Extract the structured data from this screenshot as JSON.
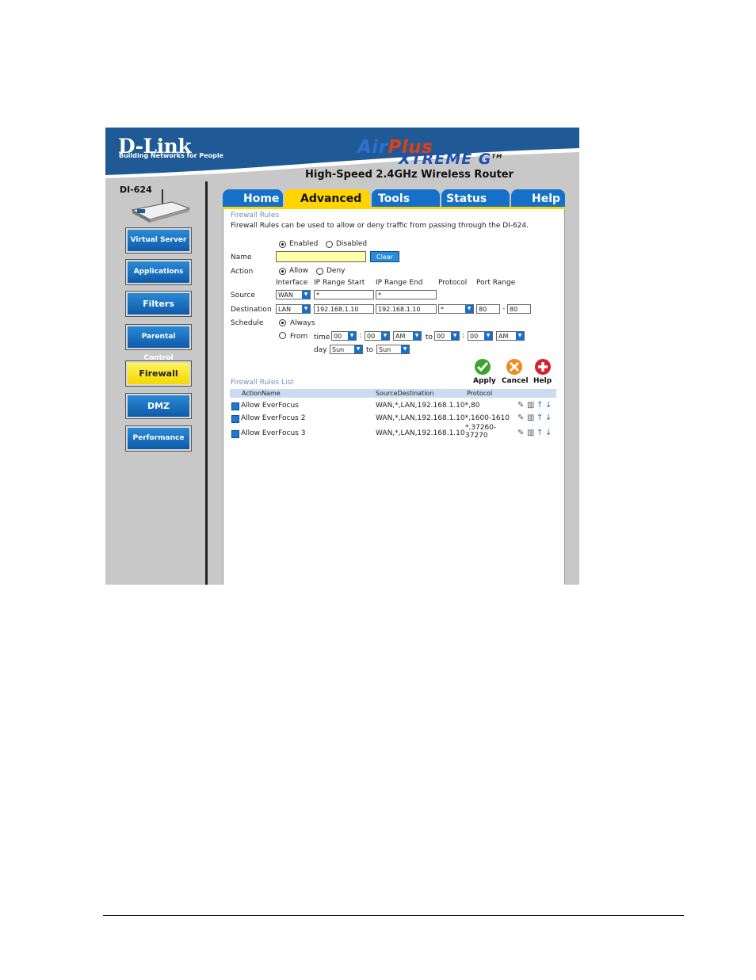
{
  "header": {
    "brand": "D-Link",
    "tagline": "Building Networks for People",
    "product_air": "Air",
    "product_plus": "Plus",
    "product_xtreme": "XTREME G",
    "trademark": "TM",
    "subtitle": "High-Speed 2.4GHz Wireless Router"
  },
  "sidebar": {
    "model": "DI-624",
    "items": [
      {
        "label": "Virtual Server"
      },
      {
        "label": "Applications"
      },
      {
        "label": "Filters"
      },
      {
        "label": "Parental Control"
      },
      {
        "label": "Firewall"
      },
      {
        "label": "DMZ"
      },
      {
        "label": "Performance"
      }
    ]
  },
  "tabs": [
    {
      "label": "Home"
    },
    {
      "label": "Advanced"
    },
    {
      "label": "Tools"
    },
    {
      "label": "Status"
    },
    {
      "label": "Help"
    }
  ],
  "form": {
    "heading": "Firewall Rules",
    "description": "Firewall Rules can be used to allow or deny traffic from passing through the DI-624.",
    "enabled_label": "Enabled",
    "disabled_label": "Disabled",
    "name_label": "Name",
    "name_value": "",
    "clear_label": "Clear",
    "action_label": "Action",
    "allow_label": "Allow",
    "deny_label": "Deny",
    "col_interface": "Interface",
    "col_ip_start": "IP Range Start",
    "col_ip_end": "IP Range End",
    "col_protocol": "Protocol",
    "col_port_range": "Port Range",
    "source_label": "Source",
    "source_interface": "WAN",
    "source_ip_start": "*",
    "source_ip_end": "*",
    "destination_label": "Destination",
    "dest_interface": "LAN",
    "dest_ip_start": "192.168.1.10",
    "dest_ip_end": "192.168.1.10",
    "dest_protocol": "*",
    "dest_port_start": "80",
    "dest_port_sep": "-",
    "dest_port_end": "80",
    "schedule_label": "Schedule",
    "always_label": "Always",
    "from_label": "From",
    "time_label": "time",
    "from_hour": "00",
    "from_min": "00",
    "from_ampm": "AM",
    "to_label": "to",
    "to_hour": "00",
    "to_min": "00",
    "to_ampm": "AM",
    "colon": ":",
    "day_label": "day",
    "from_day": "Sun",
    "to_day": "Sun"
  },
  "actions": {
    "apply_label": "Apply",
    "cancel_label": "Cancel",
    "help_label": "Help"
  },
  "rules_list": {
    "heading": "Firewall Rules List",
    "columns": {
      "action": "Action",
      "name": "Name",
      "source": "Source",
      "destination": "Destination",
      "protocol": "Protocol"
    },
    "rows": [
      {
        "name": "Allow EverFocus",
        "src_dest": "WAN,*,LAN,192.168.1.10",
        "proto": "*,80"
      },
      {
        "name": "Allow EverFocus 2",
        "src_dest": "WAN,*,LAN,192.168.1.10",
        "proto": "*,1600-1610"
      },
      {
        "name": "Allow EverFocus 3",
        "src_dest": "WAN,*,LAN,192.168.1.10",
        "proto": "*,37260-37270"
      }
    ]
  },
  "colors": {
    "blue": "#1470c8",
    "yellow": "#ffd400",
    "header_blue": "#1f5a96"
  }
}
